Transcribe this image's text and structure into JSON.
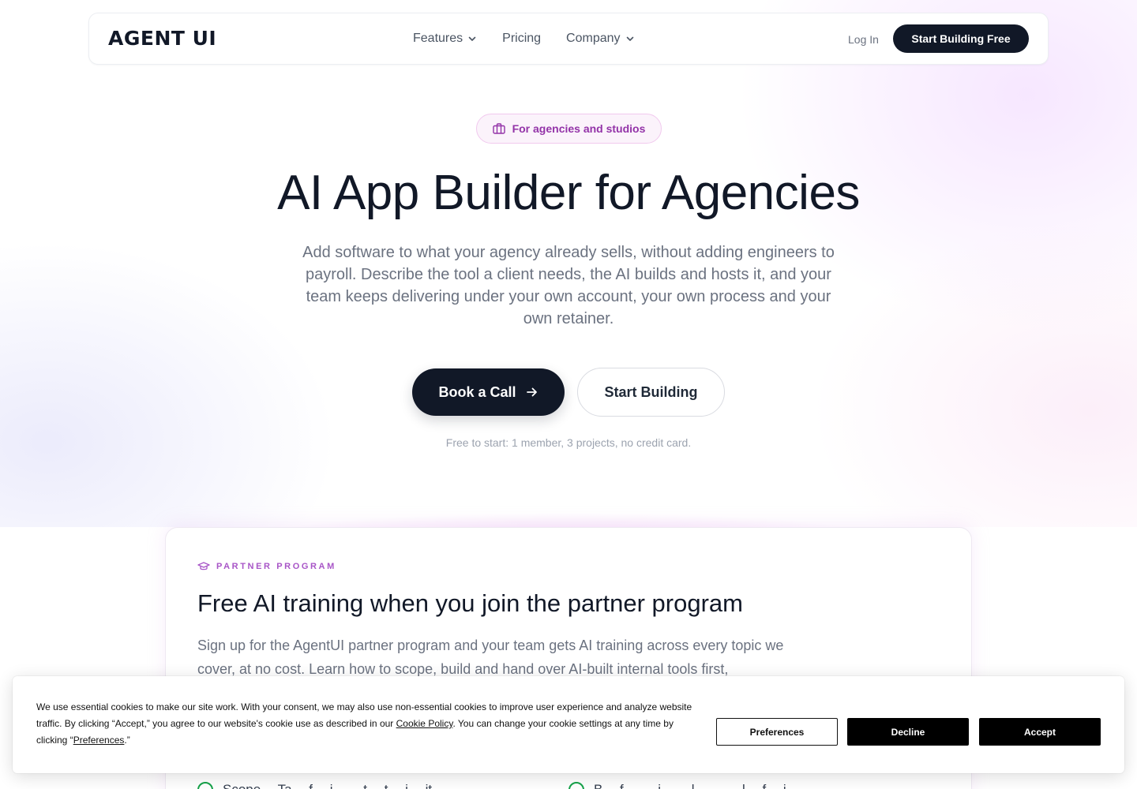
{
  "nav": {
    "logo": "AGENT UI",
    "links": [
      {
        "label": "Features",
        "has_dropdown": true
      },
      {
        "label": "Pricing",
        "has_dropdown": false
      },
      {
        "label": "Company",
        "has_dropdown": true
      }
    ],
    "login_label": "Log In",
    "cta_label": "Start Building Free"
  },
  "hero": {
    "badge_icon": "briefcase-icon",
    "badge_label": "For agencies and studios",
    "title": "AI App Builder for Agencies",
    "subtitle": "Add software to what your agency already sells, without adding engineers to payroll. Describe the tool a client needs, the AI builds and hosts it, and your team keeps delivering under your own account, your own process and your own retainer.",
    "primary_cta": "Book a Call",
    "secondary_cta": "Start Building",
    "note": "Free to start: 1 member, 3 projects, no credit card."
  },
  "partner": {
    "eyebrow_icon": "graduation-cap-icon",
    "eyebrow": "PARTNER PROGRAM",
    "title": "Free AI training when you join the partner program",
    "text": "Sign up for the AgentUI partner program and your team gets AI training across every topic we cover, at no cost. Learn how to scope, build and hand over AI-built internal tools first,",
    "features": [
      {
        "icon": "check-circle-icon",
        "label": "Scope… Ta… f… i… …t… t… i… it…"
      },
      {
        "icon": "check-circle-icon",
        "label": "B… f… … i… …l… … …l… f… i…"
      }
    ]
  },
  "cookie": {
    "text_before_policy": "We use essential cookies to make our site work. With your consent, we may also use non-essential cookies to improve user experience and analyze website traffic. By clicking “Accept,” you agree to our website's cookie use as described in our ",
    "policy_link": "Cookie Policy",
    "text_after_policy": ". You can change your cookie settings at any time by clicking “",
    "preferences_link": "Preferences",
    "text_end": ".”",
    "preferences_button": "Preferences",
    "decline_button": "Decline",
    "accept_button": "Accept"
  },
  "colors": {
    "primary_dark": "#111827",
    "accent_purple": "#9333a8",
    "check_green": "#16a34a"
  }
}
